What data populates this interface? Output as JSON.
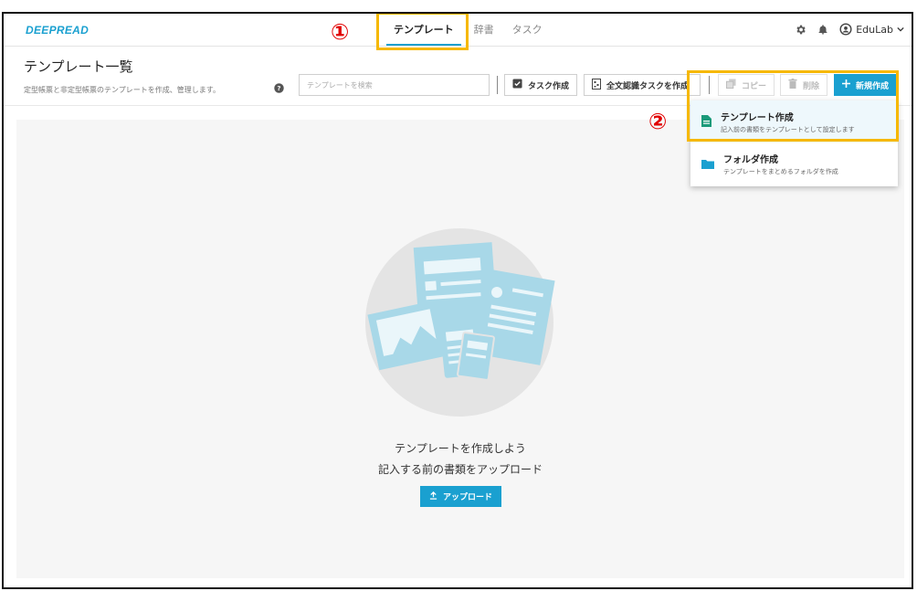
{
  "navbar": {
    "logo": "DEEPREAD",
    "tabs": [
      {
        "label": "テンプレート"
      },
      {
        "label": "辞書"
      },
      {
        "label": "タスク"
      }
    ],
    "user": "EduLab"
  },
  "header": {
    "title": "テンプレート一覧",
    "description": "定型帳票と非定型帳票のテンプレートを作成、管理します。",
    "search_placeholder": "テンプレートを検索"
  },
  "toolbar": {
    "task_create": "タスク作成",
    "fulltext_task": "全文認識タスクを作成",
    "copy": "コピー",
    "delete": "削除",
    "new_create": "新規作成"
  },
  "dropdown": {
    "items": [
      {
        "title": "テンプレート作成",
        "subtitle": "記入前の書類をテンプレートとして設定します"
      },
      {
        "title": "フォルダ作成",
        "subtitle": "テンプレートをまとめるフォルダを作成"
      }
    ]
  },
  "empty_state": {
    "title": "テンプレートを作成しよう",
    "subtitle": "記入する前の書類をアップロード",
    "upload_label": "アップロード"
  },
  "annotations": {
    "one": "①",
    "two": "②"
  },
  "colors": {
    "accent": "#1aa0d0",
    "highlight": "#f6b800",
    "annotation_red": "#e10000"
  }
}
